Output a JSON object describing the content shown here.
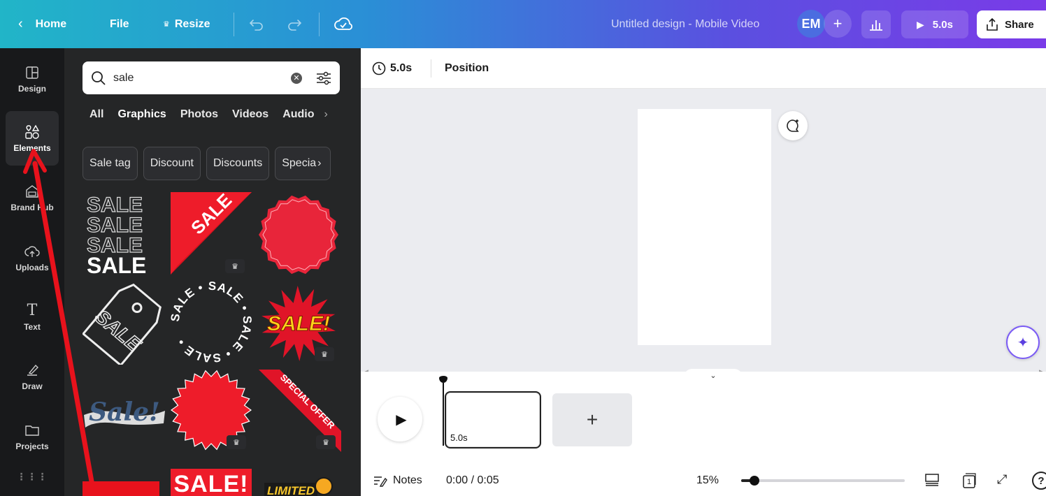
{
  "topbar": {
    "home": "Home",
    "file": "File",
    "resize": "Resize",
    "design_title": "Untitled design - Mobile Video",
    "avatar_initials": "EM",
    "add": "+",
    "play_duration": "5.0s",
    "share": "Share"
  },
  "rail": {
    "items": [
      {
        "label": "Design",
        "icon": "layout-icon"
      },
      {
        "label": "Elements",
        "icon": "shapes-icon"
      },
      {
        "label": "Brand Hub",
        "icon": "brand-icon"
      },
      {
        "label": "Uploads",
        "icon": "cloud-upload-icon"
      },
      {
        "label": "Text",
        "icon": "text-icon"
      },
      {
        "label": "Draw",
        "icon": "draw-icon"
      },
      {
        "label": "Projects",
        "icon": "folder-icon"
      }
    ]
  },
  "panel": {
    "search_value": "sale",
    "tabs": [
      "All",
      "Graphics",
      "Photos",
      "Videos",
      "Audio"
    ],
    "active_tab": "Graphics",
    "chips": [
      "Sale tag",
      "Discount",
      "Discounts",
      "Specia"
    ],
    "graphics": {
      "sale_stack": [
        "SALE",
        "SALE",
        "SALE",
        "SALE"
      ],
      "corner_sale": "SALE",
      "tag_sale": "SALE",
      "circle_sale": "SALE • SALE • SALE • SALE •",
      "burst_sale": "SALE!",
      "script_sale": "Sale!",
      "special_offer": "SPECIAL OFFER",
      "bottom_sale": "SALE!",
      "limited": "LIMITED"
    }
  },
  "context_bar": {
    "duration": "5.0s",
    "position": "Position"
  },
  "timeline": {
    "clip_duration": "5.0s",
    "add": "+"
  },
  "bottombar": {
    "notes": "Notes",
    "time": "0:00 / 0:05",
    "zoom": "15%",
    "page_count": "1",
    "zoom_level": 0.08
  },
  "colors": {
    "accent": "#8b78ff",
    "annotation_arrow": "#e8121c",
    "sale_red": "#e8253a"
  }
}
